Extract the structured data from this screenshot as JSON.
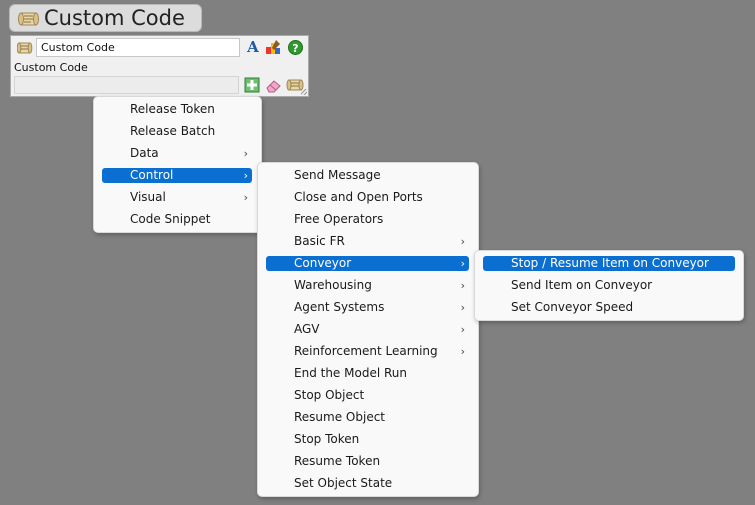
{
  "title": "Custom Code",
  "panel": {
    "name_value": "Custom Code",
    "code_label": "Custom Code",
    "font_glyph": "A",
    "help_glyph": "?"
  },
  "menu1": {
    "items": [
      {
        "label": "Release Token",
        "submenu": false
      },
      {
        "label": "Release Batch",
        "submenu": false
      },
      {
        "label": "Data",
        "submenu": true
      },
      {
        "label": "Control",
        "submenu": true,
        "highlighted": true
      },
      {
        "label": "Visual",
        "submenu": true
      },
      {
        "label": "Code Snippet",
        "submenu": false
      }
    ]
  },
  "menu2": {
    "items": [
      {
        "label": "Send Message",
        "submenu": false
      },
      {
        "label": "Close and Open Ports",
        "submenu": false
      },
      {
        "label": "Free Operators",
        "submenu": false
      },
      {
        "label": "Basic FR",
        "submenu": true
      },
      {
        "label": "Conveyor",
        "submenu": true,
        "highlighted": true
      },
      {
        "label": "Warehousing",
        "submenu": true
      },
      {
        "label": "Agent Systems",
        "submenu": true
      },
      {
        "label": "AGV",
        "submenu": true
      },
      {
        "label": "Reinforcement Learning",
        "submenu": true
      },
      {
        "label": "End the Model Run",
        "submenu": false
      },
      {
        "label": "Stop Object",
        "submenu": false
      },
      {
        "label": "Resume Object",
        "submenu": false
      },
      {
        "label": "Stop Token",
        "submenu": false
      },
      {
        "label": "Resume Token",
        "submenu": false
      },
      {
        "label": "Set Object State",
        "submenu": false
      }
    ]
  },
  "menu3": {
    "items": [
      {
        "label": "Stop / Resume Item on Conveyor",
        "submenu": false,
        "highlighted": true
      },
      {
        "label": "Send Item on Conveyor",
        "submenu": false
      },
      {
        "label": "Set Conveyor Speed",
        "submenu": false
      }
    ]
  },
  "arrow_glyph": "›",
  "colors": {
    "background": "#808080",
    "highlight": "#0a6fd1",
    "menu_bg": "#f9f9f9"
  }
}
